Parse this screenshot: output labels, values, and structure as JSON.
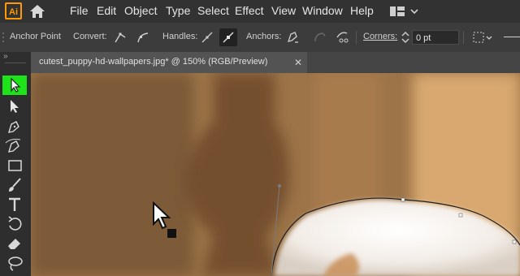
{
  "app": {
    "logo": "Ai"
  },
  "menu": [
    "File",
    "Edit",
    "Object",
    "Type",
    "Select",
    "Effect",
    "View",
    "Window",
    "Help"
  ],
  "control_bar": {
    "anchor_point": "Anchor Point",
    "convert": "Convert:",
    "handles": "Handles:",
    "anchors": "Anchors:",
    "corners": "Corners:",
    "corner_value": "0 pt"
  },
  "document_tab": {
    "title": "cutest_puppy-hd-wallpapers.jpg* @ 150% (RGB/Preview)",
    "close": "✕"
  },
  "toolbar": {
    "collapse": "»"
  },
  "icons": {
    "home": "home-icon",
    "workspace": "workspace-switcher-icon",
    "selection": "selection-tool-icon",
    "direct_selection": "direct-selection-tool-icon",
    "pen": "pen-tool-icon",
    "curvature": "curvature-tool-icon",
    "rectangle": "rectangle-tool-icon",
    "paintbrush": "paintbrush-tool-icon",
    "type": "type-tool-icon",
    "rotate": "rotate-tool-icon",
    "eraser": "eraser-tool-icon",
    "lasso": "lasso-tool-icon"
  },
  "colors": {
    "active_tool": "#1ee21a",
    "logo": "#ff9a00"
  }
}
